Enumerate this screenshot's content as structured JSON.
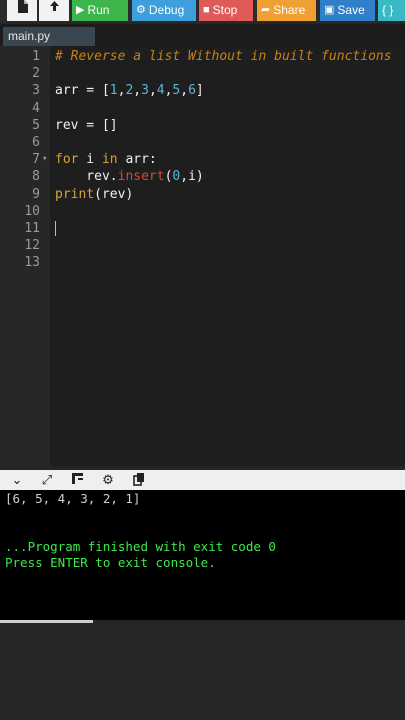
{
  "toolbar": {
    "run_label": "Run",
    "debug_label": "Debug",
    "stop_label": "Stop",
    "share_label": "Share",
    "save_label": "Save",
    "beautify_label": "{ }"
  },
  "tabs": [
    {
      "label": "main.py"
    }
  ],
  "editor": {
    "line_numbers": [
      "1",
      "2",
      "3",
      "4",
      "5",
      "6",
      "7",
      "8",
      "9",
      "10",
      "11",
      "12",
      "13"
    ],
    "lines": {
      "l1_comment": "# Reverse a list Without in built functions",
      "l3_a": "arr = [",
      "l3_n1": "1",
      "l3_n2": "2",
      "l3_n3": "3",
      "l3_n4": "4",
      "l3_n5": "5",
      "l3_n6": "6",
      "l3_b": "]",
      "l5": "rev = []",
      "l7_kw1": "for",
      "l7_mid": " i ",
      "l7_kw2": "in",
      "l7_end": " arr:",
      "l8_a": "    rev.",
      "l8_fn": "insert",
      "l8_b": "(",
      "l8_n": "0",
      "l8_c": ",i)",
      "l9_fn": "print",
      "l9_rest": "(rev)"
    }
  },
  "console": {
    "output_line": "[6, 5, 4, 3, 2, 1]",
    "finished_line": "...Program finished with exit code 0",
    "press_enter_line": "Press ENTER to exit console."
  },
  "colors": {
    "run": "#3cb54a",
    "debug": "#3d9fdc",
    "stop": "#e05a57",
    "share": "#f0a032",
    "save": "#2f7fc9",
    "console_green": "#3ee94a"
  }
}
